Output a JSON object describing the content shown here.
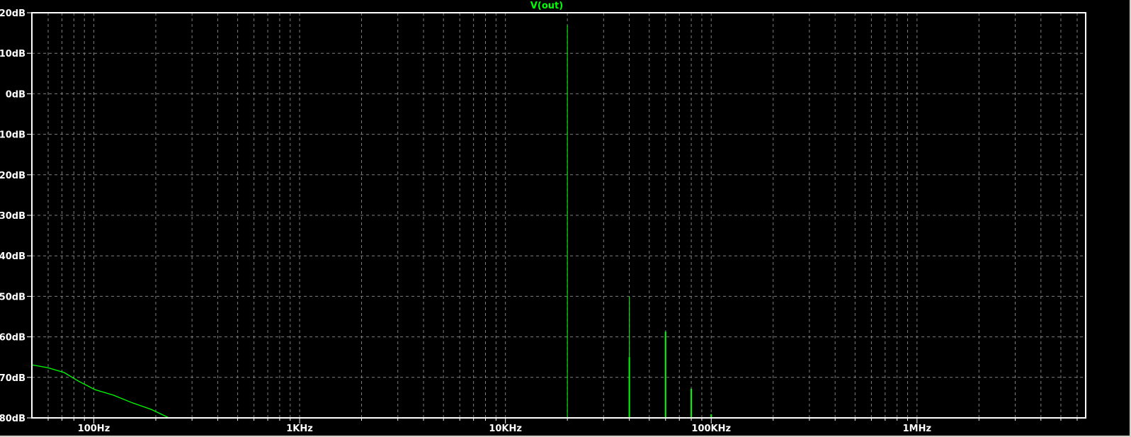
{
  "chart_data": {
    "type": "line",
    "title": "V(out)",
    "xlabel": "",
    "ylabel": "",
    "xscale": "log",
    "xlim": [
      50,
      6600000
    ],
    "ylim": [
      -80,
      20
    ],
    "grid": true,
    "x_ticks": [
      {
        "value": 100,
        "label": "100Hz"
      },
      {
        "value": 1000,
        "label": "1KHz"
      },
      {
        "value": 10000,
        "label": "10KHz"
      },
      {
        "value": 100000,
        "label": "100KHz"
      },
      {
        "value": 1000000,
        "label": "1MHz"
      }
    ],
    "y_ticks": [
      {
        "value": 20,
        "label": "20dB"
      },
      {
        "value": 10,
        "label": "10dB"
      },
      {
        "value": 0,
        "label": "0dB"
      },
      {
        "value": -10,
        "label": "-10dB"
      },
      {
        "value": -20,
        "label": "-20dB"
      },
      {
        "value": -30,
        "label": "-30dB"
      },
      {
        "value": -40,
        "label": "-40dB"
      },
      {
        "value": -50,
        "label": "-50dB"
      },
      {
        "value": -60,
        "label": "-60dB"
      },
      {
        "value": -70,
        "label": "-70dB"
      },
      {
        "value": -80,
        "label": "-80dB"
      }
    ],
    "series": [
      {
        "name": "V(out)",
        "color": "#00ff00",
        "curve": [
          [
            50,
            -66.9
          ],
          [
            59.6,
            -67.6
          ],
          [
            71.7,
            -68.8
          ],
          [
            84,
            -70.9
          ],
          [
            101,
            -73.0
          ],
          [
            124.8,
            -74.4
          ],
          [
            154,
            -76.3
          ],
          [
            190,
            -77.9
          ],
          [
            232,
            -80
          ]
        ],
        "spikes": [
          {
            "freq": 20000,
            "db": 16.9,
            "width": 1
          },
          {
            "freq": 40000,
            "db": -50,
            "width": 1
          },
          {
            "freq": 40000,
            "db": -65,
            "width": 2
          },
          {
            "freq": 60000,
            "db": -58.7,
            "width": 2
          },
          {
            "freq": 80000,
            "db": -72.8,
            "width": 2
          },
          {
            "freq": 100000,
            "db": -79.1,
            "width": 2
          }
        ]
      }
    ],
    "colors": {
      "background": "#000000",
      "axis": "#ffffff",
      "grid": "#808080",
      "trace": "#00ff00"
    }
  }
}
